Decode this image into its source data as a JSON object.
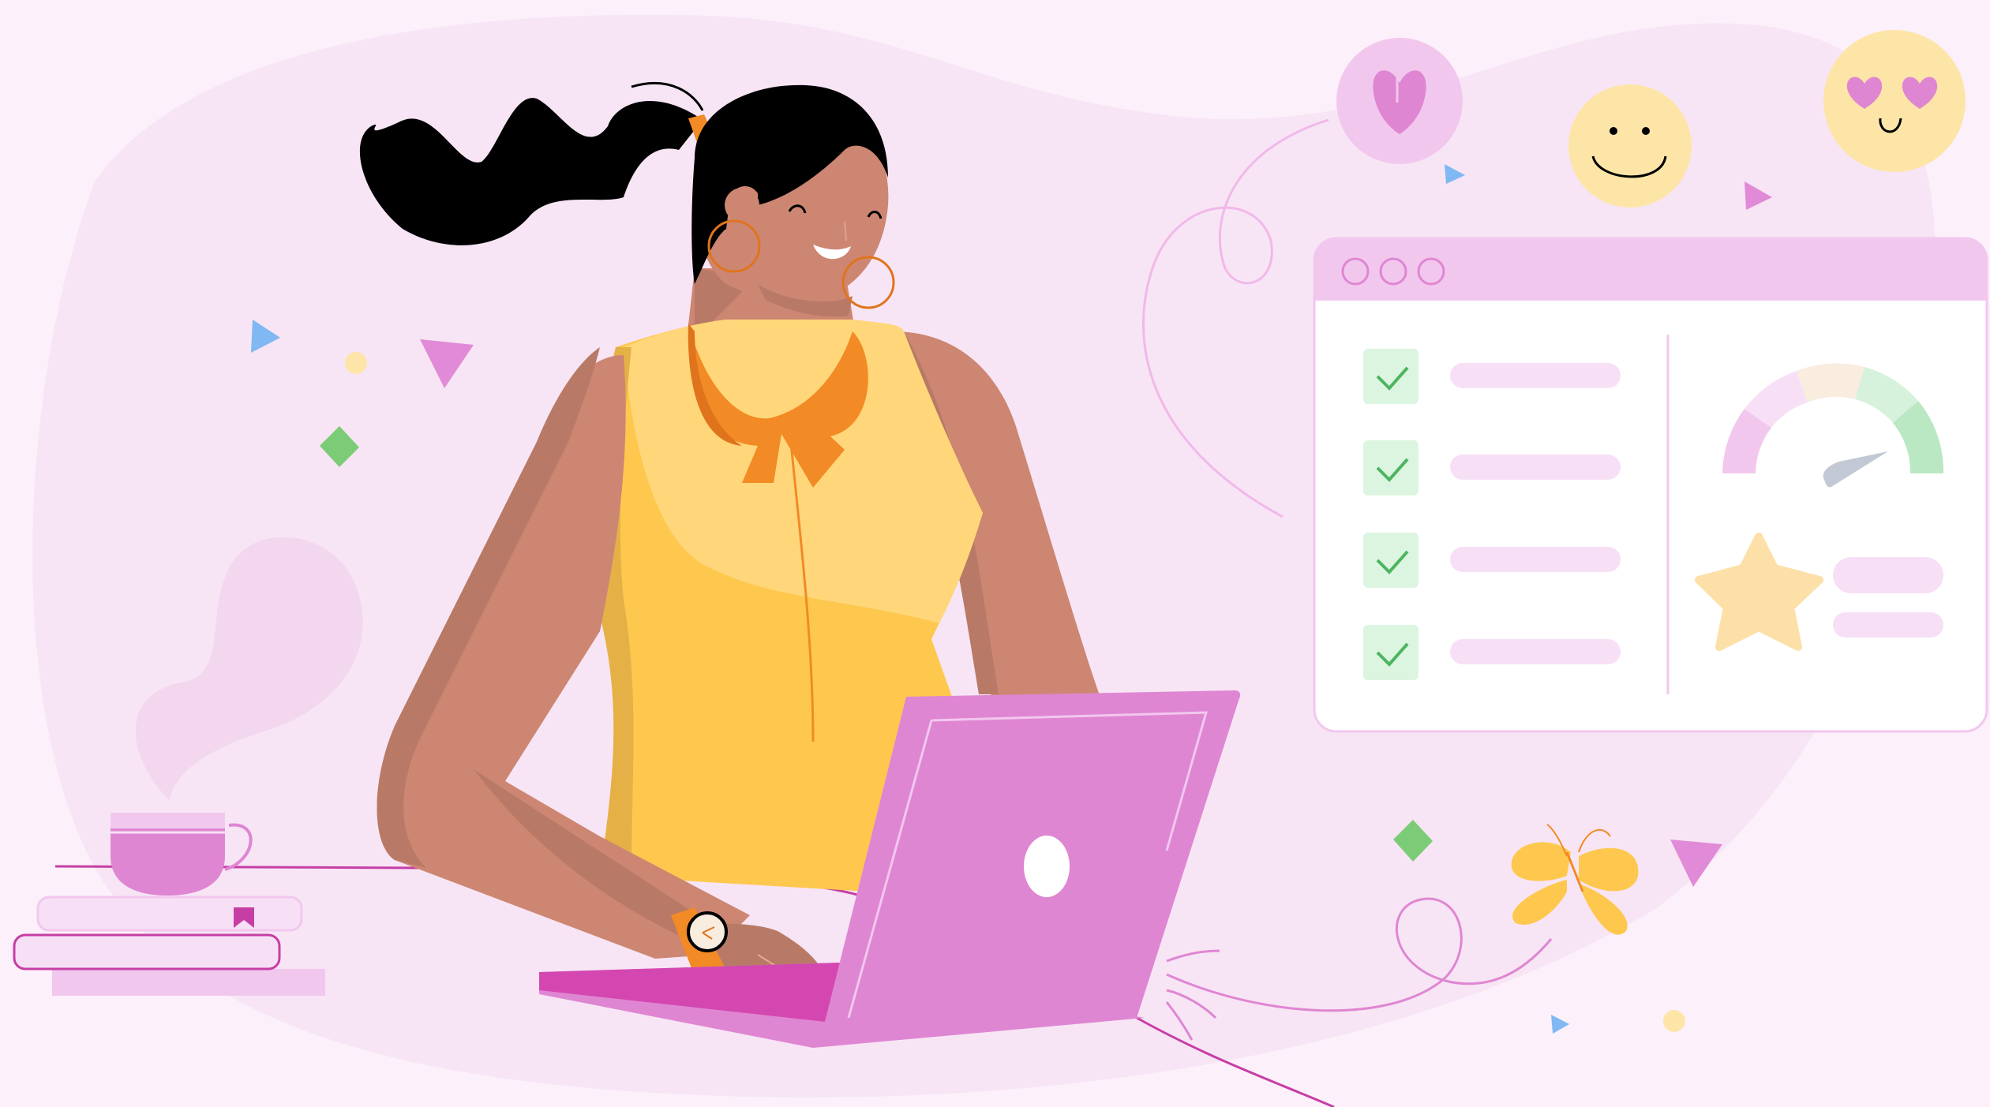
{
  "scene": {
    "type": "illustration",
    "palette": {
      "background": "#fcf0fa",
      "blob": "#f7e5f5",
      "skin": "#cd8672",
      "skin_shadow": "#b87a67",
      "hair": "#000000",
      "top": "#fec84f",
      "top_light": "#ffd77a",
      "scarf": "#f28a25",
      "laptop": "#df86d2",
      "laptop_dark": "#d447b1",
      "window_header": "#f2c7ee",
      "check_box": "#dcf5e0",
      "check_mark": "#4cb560",
      "placeholder_bar": "#f7e0f5",
      "gauge_pink": "#f2c7ee",
      "gauge_cream": "#f9ede0",
      "gauge_mint": "#d6f2dc",
      "gauge_green": "#b9e8c2",
      "needle": "#c3c9d4",
      "star": "#fce0a8",
      "emoji": "#fde5a8",
      "heart": "#e18ad7",
      "butterfly": "#fec84f"
    },
    "dashboard_window": {
      "controls": [
        "circle-icon",
        "circle-icon",
        "circle-icon"
      ],
      "checklist_items": 4,
      "icons": [
        "checkmark-icon",
        "gauge-icon",
        "star-icon"
      ]
    },
    "reactions": [
      "heart-icon",
      "smiley-face-icon",
      "heart-eyes-face-icon"
    ]
  }
}
